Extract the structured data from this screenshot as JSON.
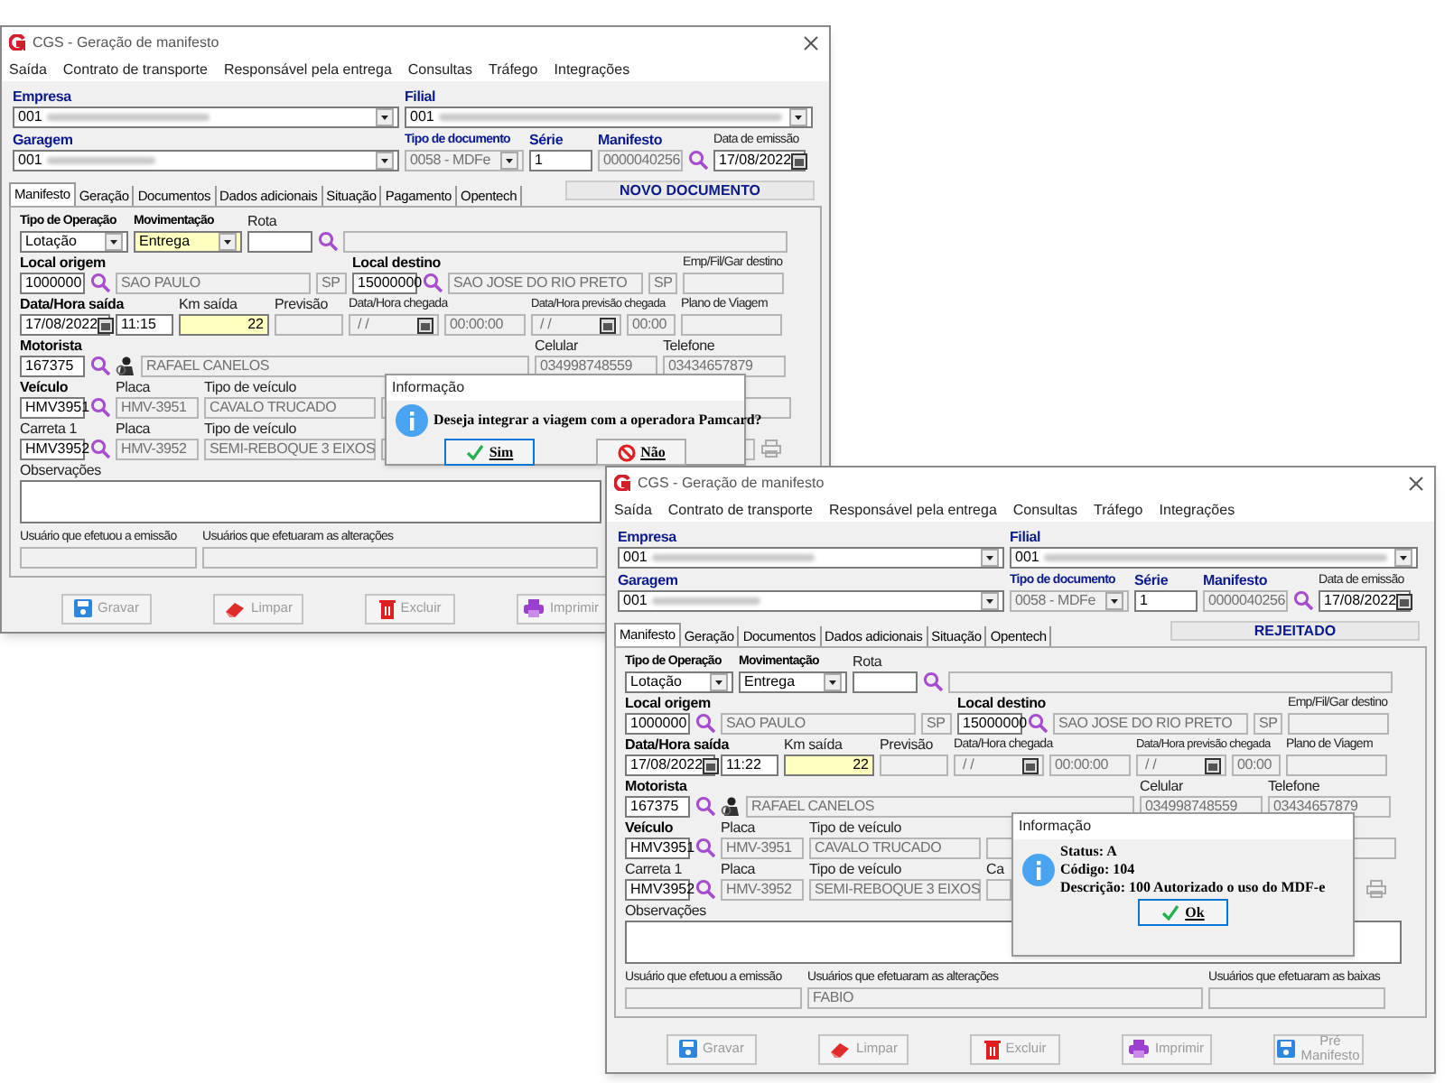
{
  "windows": [
    {
      "title": "CGS - Geração de manifesto",
      "menu": [
        "Saída",
        "Contrato de transporte",
        "Responsável pela entrega",
        "Consultas",
        "Tráfego",
        "Integrações"
      ],
      "header": {
        "empresa": {
          "label": "Empresa",
          "value": "001"
        },
        "filial": {
          "label": "Filial",
          "value": "001"
        },
        "garagem": {
          "label": "Garagem",
          "value": "001"
        },
        "tipo_documento": {
          "label": "Tipo de documento",
          "value": "0058 - MDFe"
        },
        "serie": {
          "label": "Série",
          "value": "1"
        },
        "manifesto": {
          "label": "Manifesto",
          "value": "0000040256"
        },
        "data_emissao": {
          "label": "Data de emissão",
          "value": "17/08/2022"
        }
      },
      "tabs": [
        {
          "label": "Manifesto",
          "selected": true
        },
        {
          "label": "Geração",
          "selected": false
        },
        {
          "label": "Documentos",
          "selected": false
        },
        {
          "label": "Dados adicionais",
          "selected": false
        },
        {
          "label": "Situação",
          "selected": false
        },
        {
          "label": "Pagamento",
          "selected": false
        },
        {
          "label": "Opentech",
          "selected": false
        }
      ],
      "status": "NOVO DOCUMENTO",
      "form": {
        "tipo_operacao": {
          "label": "Tipo de Operação",
          "value": "Lotação"
        },
        "movimentacao": {
          "label": "Movimentação",
          "value": "Entrega",
          "highlighted": true
        },
        "rota": {
          "label": "Rota"
        },
        "local_origem": {
          "label": "Local origem",
          "value": "1000000"
        },
        "origem_nome": {
          "value": "SAO PAULO"
        },
        "origem_uf": {
          "value": "SP"
        },
        "local_destino": {
          "label": "Local destino",
          "value": "15000000"
        },
        "destino_nome": {
          "value": "SAO JOSE DO RIO PRETO"
        },
        "destino_uf": {
          "value": "SP"
        },
        "emp_fil_gar": {
          "label": "Emp/Fil/Gar destino"
        },
        "data_saida": {
          "label": "Data/Hora saída",
          "value": "17/08/2022"
        },
        "hora_saida": {
          "value": "11:15"
        },
        "km_saida": {
          "label": "Km saída",
          "value": "22",
          "highlighted": true
        },
        "previsao": {
          "label": "Previsão"
        },
        "data_chegada": {
          "label": "Data/Hora chegada",
          "value": " / /"
        },
        "hora_chegada": {
          "value": "00:00:00"
        },
        "data_prev": {
          "label": "Data/Hora previsão chegada",
          "value": " / /"
        },
        "hora_prev": {
          "value": "00:00"
        },
        "plano": {
          "label": "Plano de Viagem"
        },
        "motorista": {
          "label": "Motorista",
          "value": "167375"
        },
        "motorista_nome": {
          "value": "RAFAEL CANELOS"
        },
        "celular": {
          "label": "Celular",
          "value": "034998748559"
        },
        "telefone": {
          "label": "Telefone",
          "value": "03434657879"
        },
        "veiculo": {
          "label": "Veículo",
          "value": "HMV3951"
        },
        "veiculo_placa": {
          "label": "Placa",
          "value": "HMV-3951"
        },
        "veiculo_tipo": {
          "label": "Tipo de veículo",
          "value": "CAVALO TRUCADO"
        },
        "carreta": {
          "label": "Carreta 1",
          "value": "HMV3952"
        },
        "carreta_placa": {
          "label": "Placa",
          "value": "HMV-3952"
        },
        "carreta_tipo": {
          "label": "Tipo de veículo",
          "value": "SEMI-REBOQUE 3 EIXOS"
        },
        "observacoes": {
          "label": "Observações"
        },
        "usuario_emissao": {
          "label": "Usuário que efetuou a emissão"
        },
        "usuario_alteracoes": {
          "label": "Usuários que efetuaram as alterações"
        }
      },
      "buttons": [
        {
          "label": "Gravar",
          "kind": "save",
          "disabled": true
        },
        {
          "label": "Limpar",
          "kind": "eraser",
          "disabled": true
        },
        {
          "label": "Excluir",
          "kind": "trash",
          "disabled": true
        },
        {
          "label": "Imprimir",
          "kind": "print",
          "disabled": true
        }
      ],
      "dialog": {
        "title": "Informação",
        "lines": [
          "Deseja integrar a viagem com a operadora Pamcard?"
        ],
        "buttons": [
          {
            "label": "Sim",
            "kind": "yes",
            "focused": true
          },
          {
            "label": "Não",
            "kind": "no",
            "focused": false
          }
        ]
      }
    },
    {
      "title": "CGS - Geração de manifesto",
      "menu": [
        "Saída",
        "Contrato de transporte",
        "Responsável pela entrega",
        "Consultas",
        "Tráfego",
        "Integrações"
      ],
      "header": {
        "empresa": {
          "label": "Empresa",
          "value": "001"
        },
        "filial": {
          "label": "Filial",
          "value": "001"
        },
        "garagem": {
          "label": "Garagem",
          "value": "001"
        },
        "tipo_documento": {
          "label": "Tipo de documento",
          "value": "0058 - MDFe"
        },
        "serie": {
          "label": "Série",
          "value": "1"
        },
        "manifesto": {
          "label": "Manifesto",
          "value": "0000040256"
        },
        "data_emissao": {
          "label": "Data de emissão",
          "value": "17/08/2022"
        }
      },
      "tabs": [
        {
          "label": "Manifesto",
          "selected": true
        },
        {
          "label": "Geração",
          "selected": false
        },
        {
          "label": "Documentos",
          "selected": false
        },
        {
          "label": "Dados adicionais",
          "selected": false
        },
        {
          "label": "Situação",
          "selected": false
        },
        {
          "label": "Opentech",
          "selected": false
        }
      ],
      "status": "REJEITADO",
      "form": {
        "tipo_operacao": {
          "label": "Tipo de Operação",
          "value": "Lotação"
        },
        "movimentacao": {
          "label": "Movimentação",
          "value": "Entrega",
          "highlighted": false
        },
        "rota": {
          "label": "Rota"
        },
        "local_origem": {
          "label": "Local origem",
          "value": "1000000"
        },
        "origem_nome": {
          "value": "SAO PAULO"
        },
        "origem_uf": {
          "value": "SP"
        },
        "local_destino": {
          "label": "Local destino",
          "value": "15000000"
        },
        "destino_nome": {
          "value": "SAO JOSE DO RIO PRETO"
        },
        "destino_uf": {
          "value": "SP"
        },
        "emp_fil_gar": {
          "label": "Emp/Fil/Gar destino"
        },
        "data_saida": {
          "label": "Data/Hora saída",
          "value": "17/08/2022"
        },
        "hora_saida": {
          "value": "11:22"
        },
        "km_saida": {
          "label": "Km saída",
          "value": "22",
          "highlighted": true
        },
        "previsao": {
          "label": "Previsão"
        },
        "data_chegada": {
          "label": "Data/Hora chegada",
          "value": " / /"
        },
        "hora_chegada": {
          "value": "00:00:00"
        },
        "data_prev": {
          "label": "Data/Hora previsão chegada",
          "value": " / /"
        },
        "hora_prev": {
          "value": "00:00"
        },
        "plano": {
          "label": "Plano de Viagem"
        },
        "motorista": {
          "label": "Motorista",
          "value": "167375"
        },
        "motorista_nome": {
          "value": "RAFAEL CANELOS"
        },
        "celular": {
          "label": "Celular",
          "value": "034998748559"
        },
        "telefone": {
          "label": "Telefone",
          "value": "03434657879"
        },
        "veiculo": {
          "label": "Veículo",
          "value": "HMV3951"
        },
        "veiculo_placa": {
          "label": "Placa",
          "value": "HMV-3951"
        },
        "veiculo_tipo": {
          "label": "Tipo de veículo",
          "value": "CAVALO TRUCADO"
        },
        "carreta": {
          "label": "Carreta 1",
          "value": "HMV3952"
        },
        "carreta_placa": {
          "label": "Placa",
          "value": "HMV-3952"
        },
        "carreta_tipo": {
          "label": "Tipo de veículo",
          "value": "SEMI-REBOQUE 3 EIXOS"
        },
        "carreta_extra": {
          "label": "Ca"
        },
        "observacoes": {
          "label": "Observações"
        },
        "usuario_emissao": {
          "label": "Usuário que efetuou a emissão"
        },
        "usuario_alteracoes": {
          "label": "Usuários que efetuaram as alterações",
          "value": "FABIO"
        },
        "usuario_baixas": {
          "label": "Usuários que efetuaram as baixas"
        }
      },
      "buttons": [
        {
          "label": "Gravar",
          "kind": "save",
          "disabled": true
        },
        {
          "label": "Limpar",
          "kind": "eraser",
          "disabled": true
        },
        {
          "label": "Excluir",
          "kind": "trash",
          "disabled": true
        },
        {
          "label": "Imprimir",
          "kind": "print",
          "disabled": true
        },
        {
          "label": "Pré Manifesto",
          "kind": "save",
          "disabled": true
        }
      ],
      "dialog": {
        "title": "Informação",
        "lines": [
          "Status: A",
          "Código: 104",
          "Descrição: 100 Autorizado o uso do MDF-e"
        ],
        "buttons": [
          {
            "label": "Ok",
            "kind": "ok",
            "focused": true
          }
        ]
      }
    }
  ]
}
